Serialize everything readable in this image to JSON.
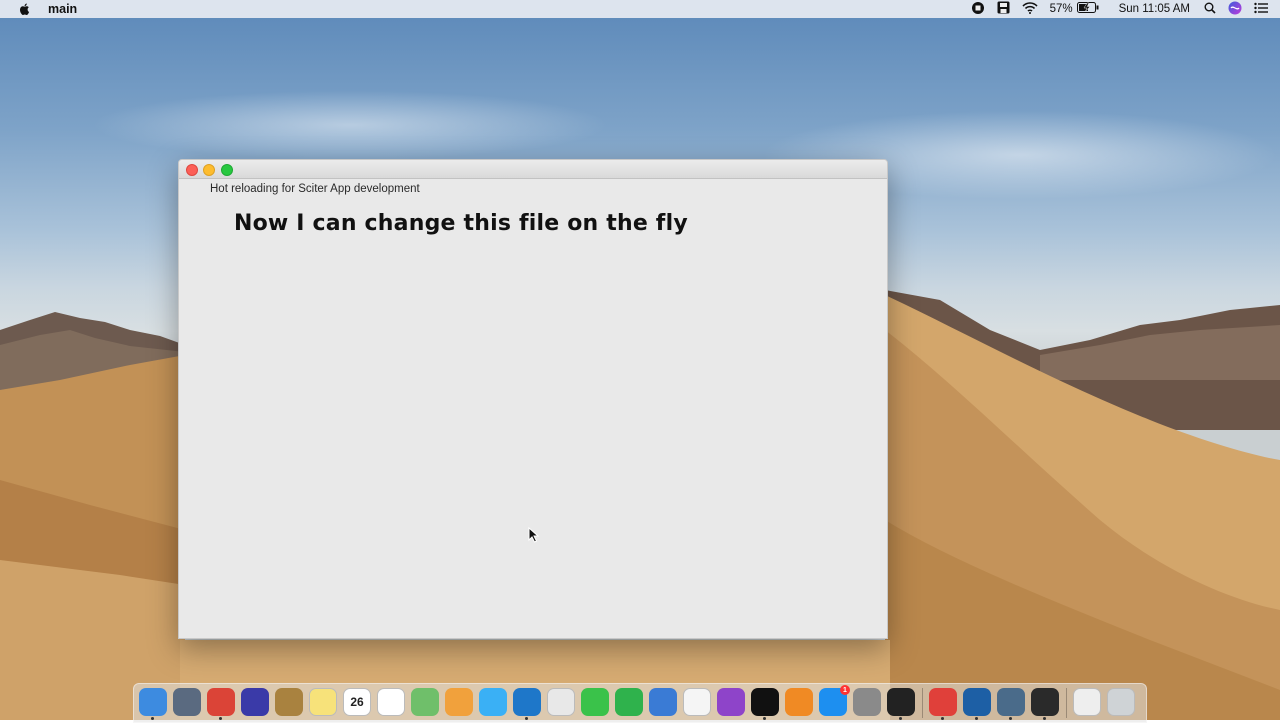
{
  "menubar": {
    "app_name": "main",
    "battery_percent": "57%",
    "clock": "Sun 11:05 AM"
  },
  "window": {
    "caption": "Hot reloading for Sciter App development",
    "heading": "Now I can change this file on the fly"
  },
  "dock": {
    "calendar_day": "26",
    "appstore_badge": "1",
    "items": [
      {
        "name": "finder",
        "color": "#3d8be0"
      },
      {
        "name": "launchpad",
        "color": "#5a6a80"
      },
      {
        "name": "chrome",
        "color": "#db4437"
      },
      {
        "name": "siri",
        "color": "#3a3aa8"
      },
      {
        "name": "contacts",
        "color": "#a9823f"
      },
      {
        "name": "notes",
        "color": "#f7e27a"
      },
      {
        "name": "calendar",
        "color": "#ffffff"
      },
      {
        "name": "reminders",
        "color": "#ffffff"
      },
      {
        "name": "maps",
        "color": "#6fbf6a"
      },
      {
        "name": "photos",
        "color": "#f1a13c"
      },
      {
        "name": "messages",
        "color": "#3ab0f5"
      },
      {
        "name": "vscode",
        "color": "#1e77c9"
      },
      {
        "name": "textedit",
        "color": "#e8e8e8"
      },
      {
        "name": "facetime",
        "color": "#3ac24a"
      },
      {
        "name": "numbers",
        "color": "#2fb24c"
      },
      {
        "name": "keynote",
        "color": "#3a7bd5"
      },
      {
        "name": "itunes",
        "color": "#f5f5f5"
      },
      {
        "name": "podcasts",
        "color": "#8e44c9"
      },
      {
        "name": "appletv",
        "color": "#111111"
      },
      {
        "name": "books",
        "color": "#f08a24"
      },
      {
        "name": "appstore",
        "color": "#1d8ff0"
      },
      {
        "name": "system-preferences",
        "color": "#8a8a8a"
      },
      {
        "name": "terminal",
        "color": "#222222"
      },
      {
        "name": "git-app",
        "color": "#e0403a"
      },
      {
        "name": "quicktime",
        "color": "#1d5fa5"
      },
      {
        "name": "network-utility",
        "color": "#4a6b8a"
      },
      {
        "name": "console",
        "color": "#2a2a2a"
      },
      {
        "name": "downloads",
        "color": "#eeeeee"
      },
      {
        "name": "trash",
        "color": "#cfd3d6"
      }
    ]
  }
}
